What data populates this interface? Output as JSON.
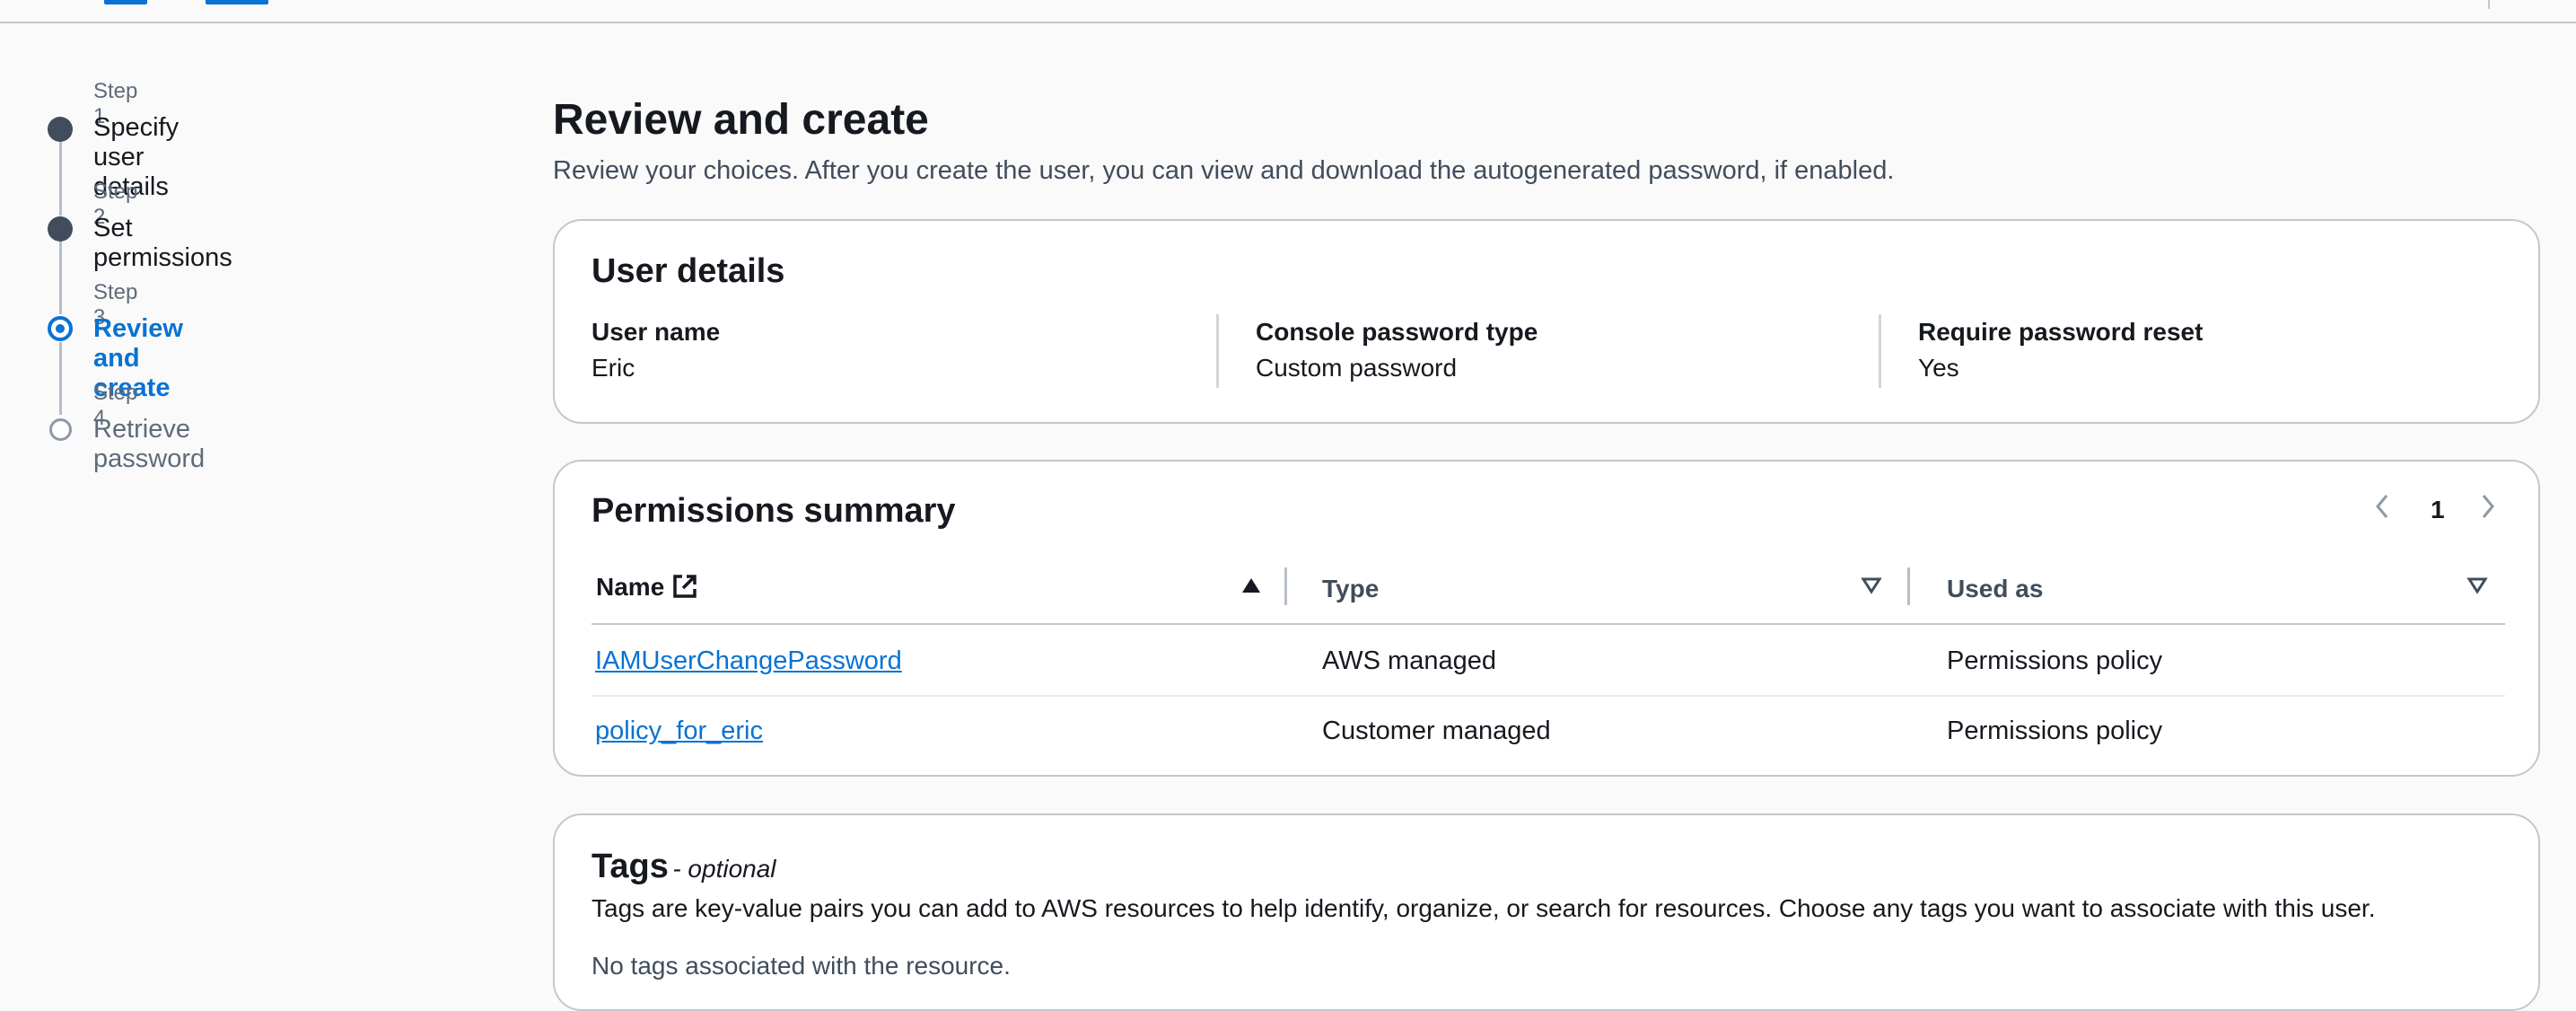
{
  "stepper": {
    "steps": [
      {
        "number": "Step 1",
        "label": "Specify user details",
        "state": "completed"
      },
      {
        "number": "Step 2",
        "label": "Set permissions",
        "state": "completed"
      },
      {
        "number": "Step 3",
        "label": "Review and create",
        "state": "current"
      },
      {
        "number": "Step 4",
        "label": "Retrieve password",
        "state": "upcoming"
      }
    ]
  },
  "page": {
    "title": "Review and create",
    "description": "Review your choices. After you create the user, you can view and download the autogenerated password, if enabled."
  },
  "user_details": {
    "title": "User details",
    "fields": [
      {
        "key": "User name",
        "value": "Eric"
      },
      {
        "key": "Console password type",
        "value": "Custom password"
      },
      {
        "key": "Require password reset",
        "value": "Yes"
      }
    ]
  },
  "permissions": {
    "title": "Permissions summary",
    "page_number": "1",
    "columns": [
      "Name",
      "Type",
      "Used as"
    ],
    "sort": {
      "column": "Name",
      "direction": "ascending"
    },
    "rows": [
      {
        "name": "IAMUserChangePassword",
        "type": "AWS managed",
        "used_as": "Permissions policy"
      },
      {
        "name": "policy_for_eric",
        "type": "Customer managed",
        "used_as": "Permissions policy"
      }
    ]
  },
  "tags": {
    "title": "Tags",
    "optional_label": "- optional",
    "description": "Tags are key-value pairs you can add to AWS resources to help identify, organize, or search for resources. Choose any tags you want to associate with this user.",
    "empty_text": "No tags associated with the resource."
  },
  "icons": {
    "external_link": "external-link-icon",
    "sort_ascending": "caret-up-filled-icon",
    "sort_none": "caret-down-icon",
    "prev": "chevron-left-icon",
    "next": "chevron-right-icon"
  },
  "colors": {
    "link": "#0972d3",
    "completed_step": "#414d5c",
    "border": "#c6c6cd",
    "background": "#fafafa"
  }
}
